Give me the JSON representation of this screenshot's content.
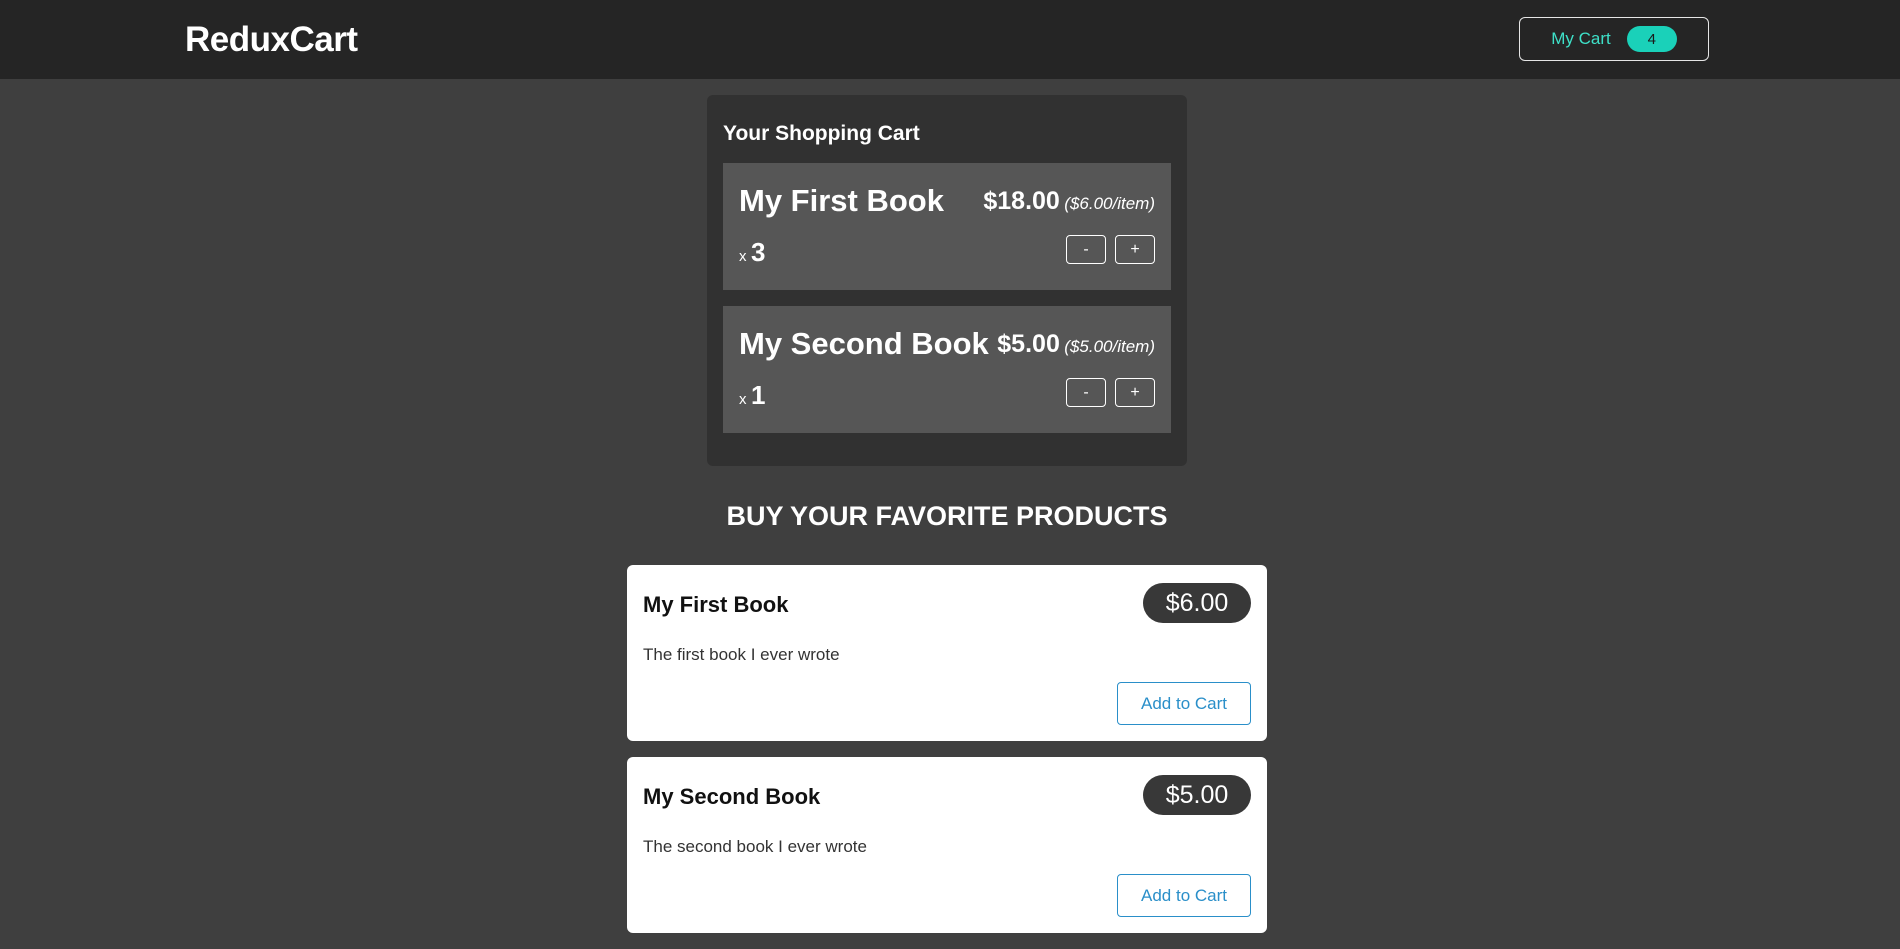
{
  "header": {
    "logo": "ReduxCart",
    "cart_button_label": "My Cart",
    "cart_count": "4"
  },
  "cart": {
    "title": "Your Shopping Cart",
    "items": [
      {
        "title": "My First Book",
        "total": "$18.00",
        "per_item": "($6.00/item)",
        "qty_prefix": "x",
        "quantity": "3",
        "decrement_label": "-",
        "increment_label": "+"
      },
      {
        "title": "My Second Book",
        "total": "$5.00",
        "per_item": "($5.00/item)",
        "qty_prefix": "x",
        "quantity": "1",
        "decrement_label": "-",
        "increment_label": "+"
      }
    ]
  },
  "products": {
    "section_title": "BUY YOUR FAVORITE PRODUCTS",
    "items": [
      {
        "title": "My First Book",
        "price": "$6.00",
        "description": "The first book I ever wrote",
        "add_label": "Add to Cart"
      },
      {
        "title": "My Second Book",
        "price": "$5.00",
        "description": "The second book I ever wrote",
        "add_label": "Add to Cart"
      }
    ]
  },
  "colors": {
    "page_bg": "#3f3f3f",
    "header_bg": "#252525",
    "accent_teal": "#1ad1b9",
    "link_blue": "#2a8fc9"
  }
}
